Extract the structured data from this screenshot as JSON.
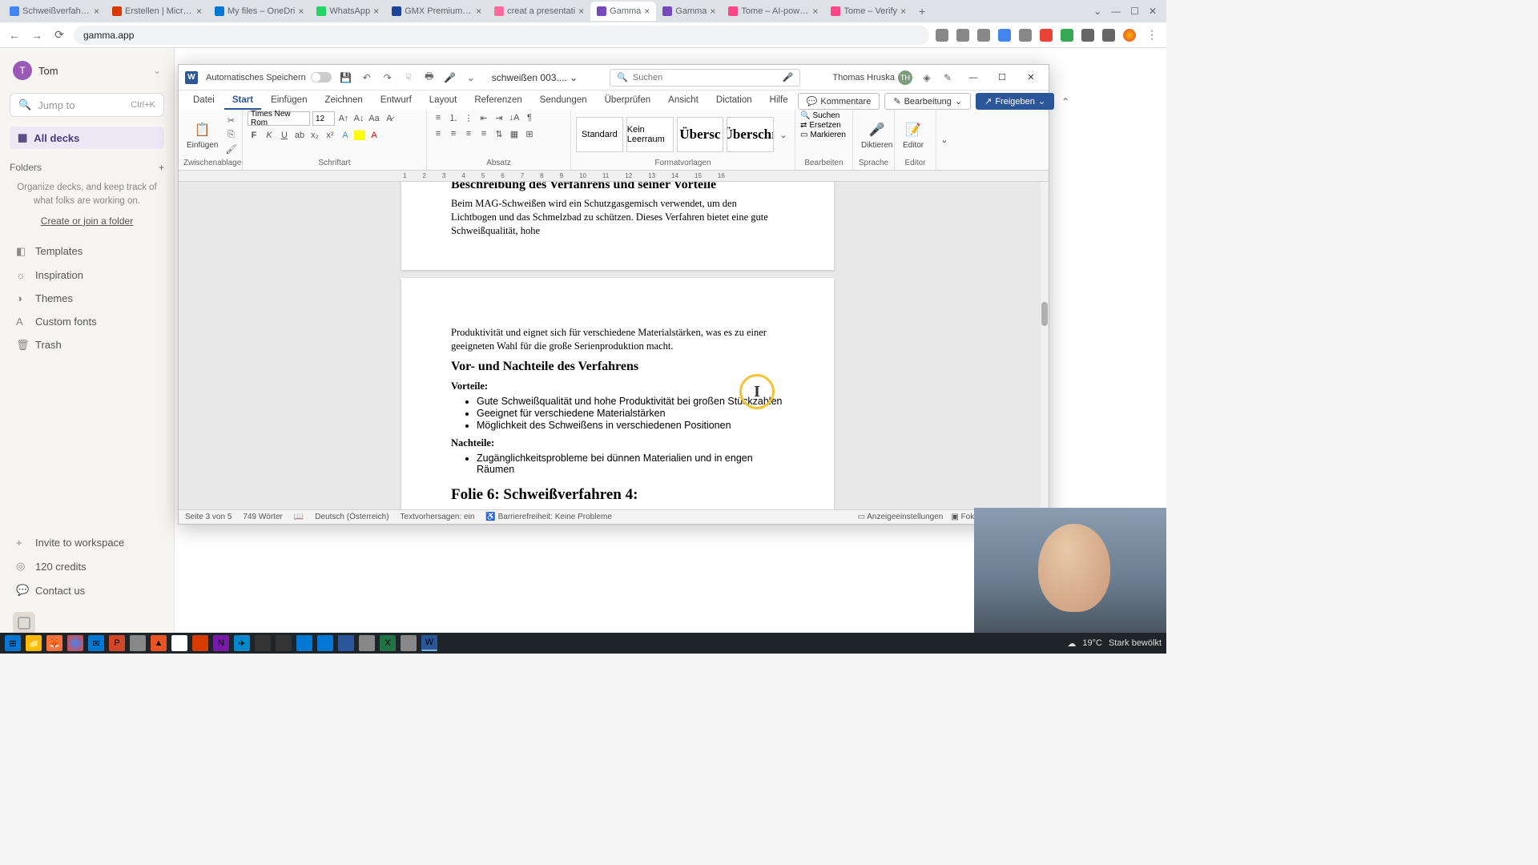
{
  "browser": {
    "tabs": [
      {
        "title": "Schweißverfahren",
        "favicon": "#4285f4"
      },
      {
        "title": "Erstellen | Microsof",
        "favicon": "#d83b01"
      },
      {
        "title": "My files – OneDri",
        "favicon": "#0078d4"
      },
      {
        "title": "WhatsApp",
        "favicon": "#25d366"
      },
      {
        "title": "GMX Premium – E",
        "favicon": "#1c449b"
      },
      {
        "title": "creat a presentati",
        "favicon": "#ff6b9d"
      },
      {
        "title": "Gamma",
        "favicon": "#764abc",
        "active": true
      },
      {
        "title": "Gamma",
        "favicon": "#764abc"
      },
      {
        "title": "Tome – AI-powere",
        "favicon": "#ff4785"
      },
      {
        "title": "Tome – Verify",
        "favicon": "#ff4785"
      }
    ],
    "url": "gamma.app"
  },
  "gamma": {
    "user_initial": "T",
    "user_name": "Tom",
    "jump_placeholder": "Jump to",
    "jump_kbd": "Ctrl+K",
    "all_decks": "All decks",
    "folders_label": "Folders",
    "folders_empty": "Organize decks, and keep track of what folks are working on.",
    "folders_cta": "Create or join a folder",
    "nav": {
      "templates": "Templates",
      "inspiration": "Inspiration",
      "themes": "Themes",
      "custom_fonts": "Custom fonts",
      "trash": "Trash",
      "invite": "Invite to workspace",
      "credits": "120 credits",
      "contact": "Contact us"
    }
  },
  "word": {
    "autosave_label": "Automatisches Speichern",
    "doc_name": "schweißen 003....",
    "search_placeholder": "Suchen",
    "user_name": "Thomas Hruska",
    "user_initials": "TH",
    "tabs": {
      "datei": "Datei",
      "start": "Start",
      "einfuegen": "Einfügen",
      "zeichnen": "Zeichnen",
      "entwurf": "Entwurf",
      "layout": "Layout",
      "referenzen": "Referenzen",
      "sendungen": "Sendungen",
      "ueberpruefen": "Überprüfen",
      "ansicht": "Ansicht",
      "dictation": "Dictation",
      "hilfe": "Hilfe"
    },
    "btn_kommentare": "Kommentare",
    "btn_bearbeitung": "Bearbeitung",
    "btn_freigeben": "Freigeben",
    "ribbon": {
      "einfuegen": "Einfügen",
      "zwischenablage": "Zwischenablage",
      "font_name": "Times New Rom",
      "font_size": "12",
      "schriftart": "Schriftart",
      "absatz": "Absatz",
      "style_standard": "Standard",
      "style_kein": "Kein Leerraum",
      "style_u1": "Übersc",
      "style_u2": "Überschr",
      "formatvorlagen": "Formatvorlagen",
      "suchen": "Suchen",
      "ersetzen": "Ersetzen",
      "markieren": "Markieren",
      "bearbeiten": "Bearbeiten",
      "diktieren": "Diktieren",
      "sprache": "Sprache",
      "editor": "Editor",
      "editor_g": "Editor"
    },
    "doc": {
      "h_top": "Beschreibung des Verfahrens und seiner Vorteile",
      "p_top": "Beim MAG-Schweißen wird ein Schutzgasgemisch verwendet, um den Lichtbogen und das Schmelzbad zu schützen. Dieses Verfahren bietet eine gute Schweißqualität, hohe",
      "p_mid": "Produktivität und eignet sich für verschiedene Materialstärken, was es zu einer geeigneten Wahl für die große Serienproduktion macht.",
      "h_vn": "Vor- und Nachteile des Verfahrens",
      "vorteile": "Vorteile:",
      "v1": "Gute Schweißqualität und hohe Produktivität bei großen Stückzahlen",
      "v2": "Geeignet für verschiedene Materialstärken",
      "v3": "Möglichkeit des Schweißens in verschiedenen Positionen",
      "nachteile": "Nachteile:",
      "n1": "Zugänglichkeitsprobleme bei dünnen Materialien und in engen Räumen",
      "h_folie": "Folie 6: Schweißverfahren 4:"
    },
    "status": {
      "page": "Seite 3 von 5",
      "words": "749 Wörter",
      "lang": "Deutsch (Österreich)",
      "predict": "Textvorhersagen: ein",
      "access": "Barrierefreiheit: Keine Probleme",
      "display": "Anzeigeeinstellungen",
      "fokus": "Fokus"
    }
  },
  "system": {
    "temp": "19°C",
    "weather": "Stark bewölkt"
  }
}
